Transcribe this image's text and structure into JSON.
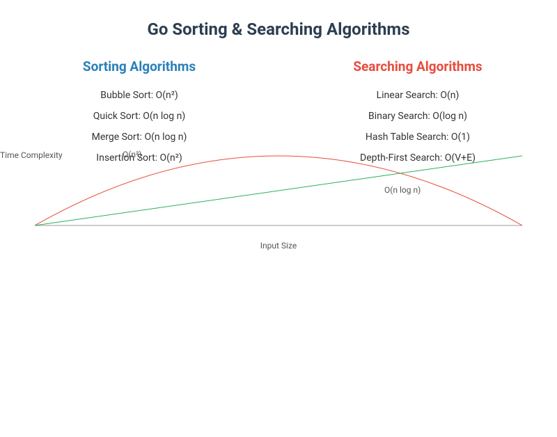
{
  "title": "Go Sorting & Searching Algorithms",
  "columns": {
    "sorting": {
      "heading": "Sorting Algorithms",
      "items": [
        "Bubble Sort: O(n²)",
        "Quick Sort: O(n log n)",
        "Merge Sort: O(n log n)",
        "Insertion Sort: O(n²)"
      ]
    },
    "searching": {
      "heading": "Searching Algorithms",
      "items": [
        "Linear Search: O(n)",
        "Binary Search: O(log n)",
        "Hash Table Search: O(1)",
        "Depth-First Search: O(V+E)"
      ]
    }
  },
  "axes": {
    "xlabel": "Input Size",
    "ylabel": "Time Complexity"
  },
  "curve_labels": {
    "n2": "O(n²)",
    "nlogn": "O(n log n)"
  },
  "chart_data": {
    "type": "line",
    "title": "Go Sorting & Searching Algorithms",
    "xlabel": "Input Size",
    "ylabel": "Time Complexity",
    "x": [
      0,
      1,
      2,
      3,
      4,
      5,
      6,
      7,
      8,
      9,
      10
    ],
    "series": [
      {
        "name": "O(n²)",
        "color": "#e74c3c",
        "values": [
          0,
          36,
          64,
          84,
          96,
          100,
          96,
          84,
          64,
          36,
          0
        ]
      },
      {
        "name": "O(n log n)",
        "color": "#27ae60",
        "values": [
          0,
          10,
          20,
          30,
          40,
          50,
          60,
          70,
          80,
          90,
          100
        ]
      }
    ],
    "xlim": [
      0,
      10
    ],
    "ylim": [
      0,
      100
    ],
    "grid": false,
    "legend": false
  }
}
